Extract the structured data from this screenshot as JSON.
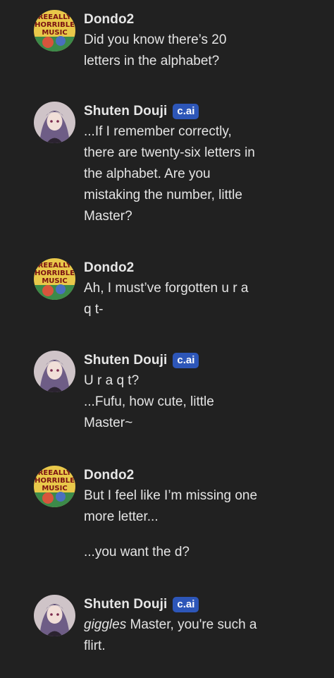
{
  "messages": [
    {
      "author": "Dondo2",
      "avatar": "album-cover-avatar",
      "lines": [
        "Did you know there’s 20",
        "letters in the alphabet?"
      ]
    },
    {
      "author": "Shuten Douji",
      "badge": "c.ai",
      "avatar": "character-portrait-avatar",
      "lines": [
        "...If I remember correctly,",
        "there are twenty-six letters in",
        "the alphabet. Are you",
        "mistaking the number, little",
        "Master?"
      ]
    },
    {
      "author": "Dondo2",
      "avatar": "album-cover-avatar",
      "lines": [
        "Ah, I must’ve forgotten u r a",
        "q t-"
      ]
    },
    {
      "author": "Shuten Douji",
      "badge": "c.ai",
      "avatar": "character-portrait-avatar",
      "lines": [
        "U r a q t?",
        "...Fufu, how cute, little",
        "Master~"
      ]
    },
    {
      "author": "Dondo2",
      "avatar": "album-cover-avatar",
      "lines": [
        "But I feel like I’m missing one",
        "more letter..."
      ],
      "extra_paragraph": "...you want the d?"
    },
    {
      "author": "Shuten Douji",
      "badge": "c.ai",
      "avatar": "character-portrait-avatar",
      "italic_prefix": "giggles",
      "line1_rest": " Master, you're such a",
      "line2": "flirt."
    }
  ],
  "avatar_art": {
    "album_text_top": "REEALLY",
    "album_text_mid": "HORRIBLE",
    "album_text_bot": "MUSIC"
  },
  "colors": {
    "background": "#212121",
    "badge": "#2d56b8",
    "name": "#e6e6e6",
    "text": "#e4e4e4"
  }
}
